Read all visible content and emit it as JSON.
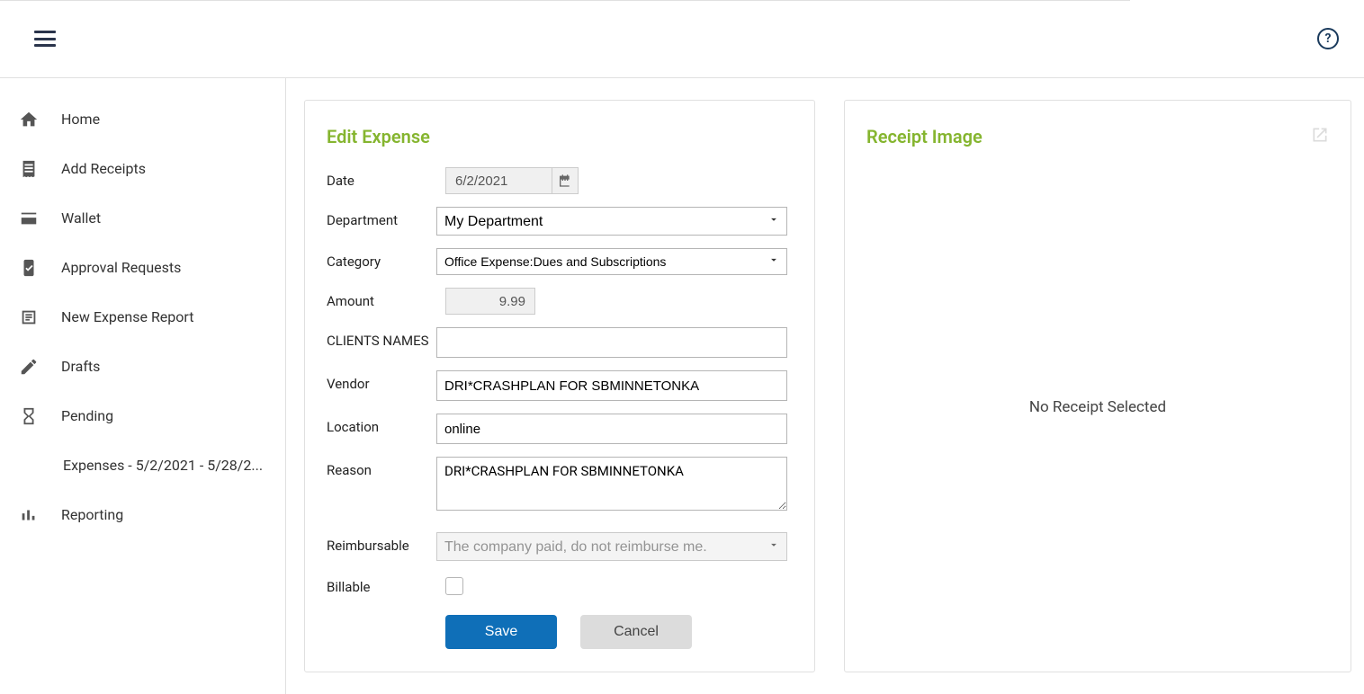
{
  "sidebar": {
    "items": [
      {
        "label": "Home"
      },
      {
        "label": "Add Receipts"
      },
      {
        "label": "Wallet"
      },
      {
        "label": "Approval Requests"
      },
      {
        "label": "New Expense Report"
      },
      {
        "label": "Drafts"
      },
      {
        "label": "Pending"
      },
      {
        "label": "Expenses - 5/2/2021 - 5/28/2..."
      },
      {
        "label": "Reporting"
      }
    ]
  },
  "form": {
    "title": "Edit Expense",
    "labels": {
      "date": "Date",
      "department": "Department",
      "category": "Category",
      "amount": "Amount",
      "clients": "CLIENTS NAMES",
      "vendor": "Vendor",
      "location": "Location",
      "reason": "Reason",
      "reimbursable": "Reimbursable",
      "billable": "Billable"
    },
    "values": {
      "date": "6/2/2021",
      "department": "My Department",
      "category": "Office Expense:Dues and Subscriptions",
      "amount": "9.99",
      "clients": "",
      "vendor": "DRI*CRASHPLAN FOR SBMINNETONKA",
      "location": "online",
      "reason": "DRI*CRASHPLAN FOR SBMINNETONKA",
      "reimbursable": "The company paid, do not reimburse me.",
      "billable": false
    },
    "buttons": {
      "save": "Save",
      "cancel": "Cancel"
    }
  },
  "receipt": {
    "title": "Receipt Image",
    "placeholder": "No Receipt Selected"
  }
}
